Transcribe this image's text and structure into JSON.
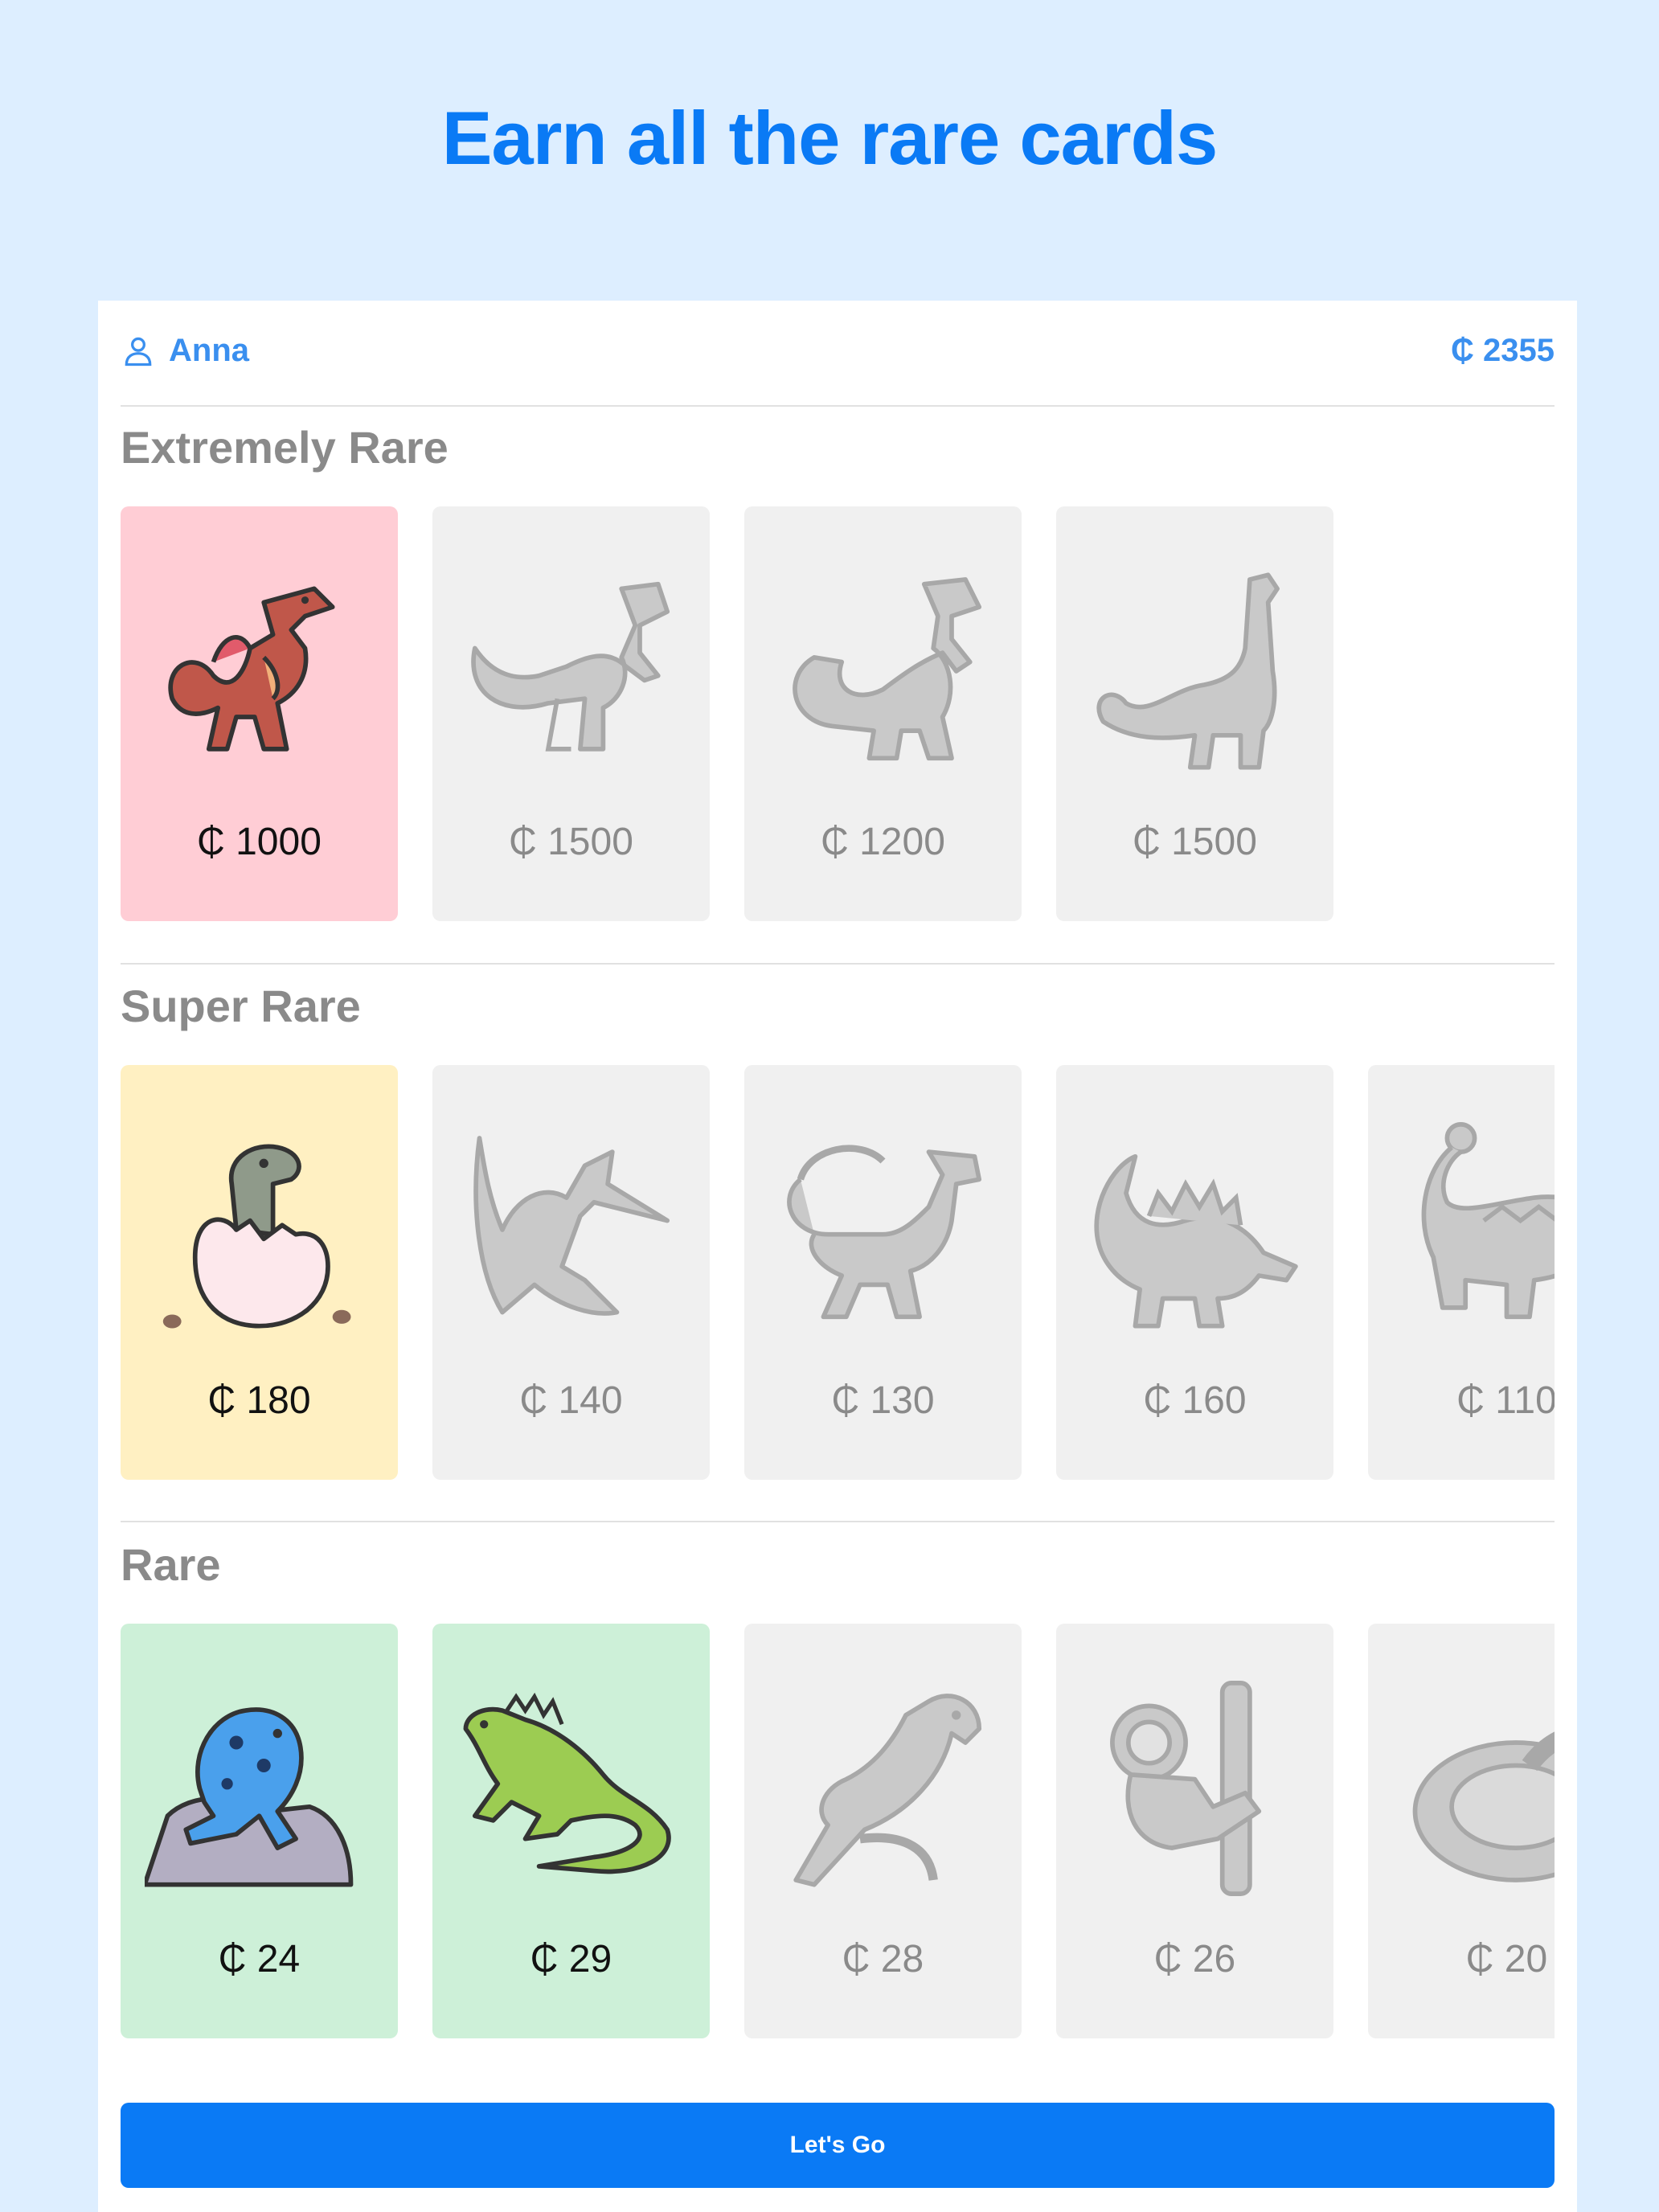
{
  "headline": "Earn all the rare cards",
  "header": {
    "user_name": "Anna",
    "coin_balance": "₵ 2355"
  },
  "sections": [
    {
      "title": "Extremely Rare",
      "cards": [
        {
          "price": "₵ 1000",
          "owned": true,
          "icon": "spinosaurus-icon",
          "color": "#ffcdd5"
        },
        {
          "price": "₵ 1500",
          "owned": false,
          "icon": "allosaurus-icon"
        },
        {
          "price": "₵ 1200",
          "owned": false,
          "icon": "t-rex-icon"
        },
        {
          "price": "₵ 1500",
          "owned": false,
          "icon": "brachiosaurus-icon"
        }
      ]
    },
    {
      "title": "Super Rare",
      "cards": [
        {
          "price": "₵ 180",
          "owned": true,
          "icon": "hatching-dinosaur-icon",
          "color": "#fff0c2"
        },
        {
          "price": "₵ 140",
          "owned": false,
          "icon": "pteranodon-icon"
        },
        {
          "price": "₵ 130",
          "owned": false,
          "icon": "feathered-dinosaur-icon"
        },
        {
          "price": "₵ 160",
          "owned": false,
          "icon": "stegosaurus-icon"
        },
        {
          "price": "₵ 110",
          "owned": false,
          "icon": "ankylosaurus-icon"
        }
      ]
    },
    {
      "title": "Rare",
      "cards": [
        {
          "price": "₵ 24",
          "owned": true,
          "icon": "poison-dart-frog-icon",
          "color": "#cdf0d8"
        },
        {
          "price": "₵ 29",
          "owned": true,
          "icon": "iguana-icon",
          "color": "#cdf0d8"
        },
        {
          "price": "₵ 28",
          "owned": false,
          "icon": "parrot-icon"
        },
        {
          "price": "₵ 26",
          "owned": false,
          "icon": "sloth-icon"
        },
        {
          "price": "₵ 20",
          "owned": false,
          "icon": "snake-icon"
        }
      ]
    }
  ],
  "cta_label": "Let's Go",
  "colors": {
    "accent": "#0a7af5",
    "page_background": "#ddeeff",
    "locked_card": "#f0f0f0"
  }
}
